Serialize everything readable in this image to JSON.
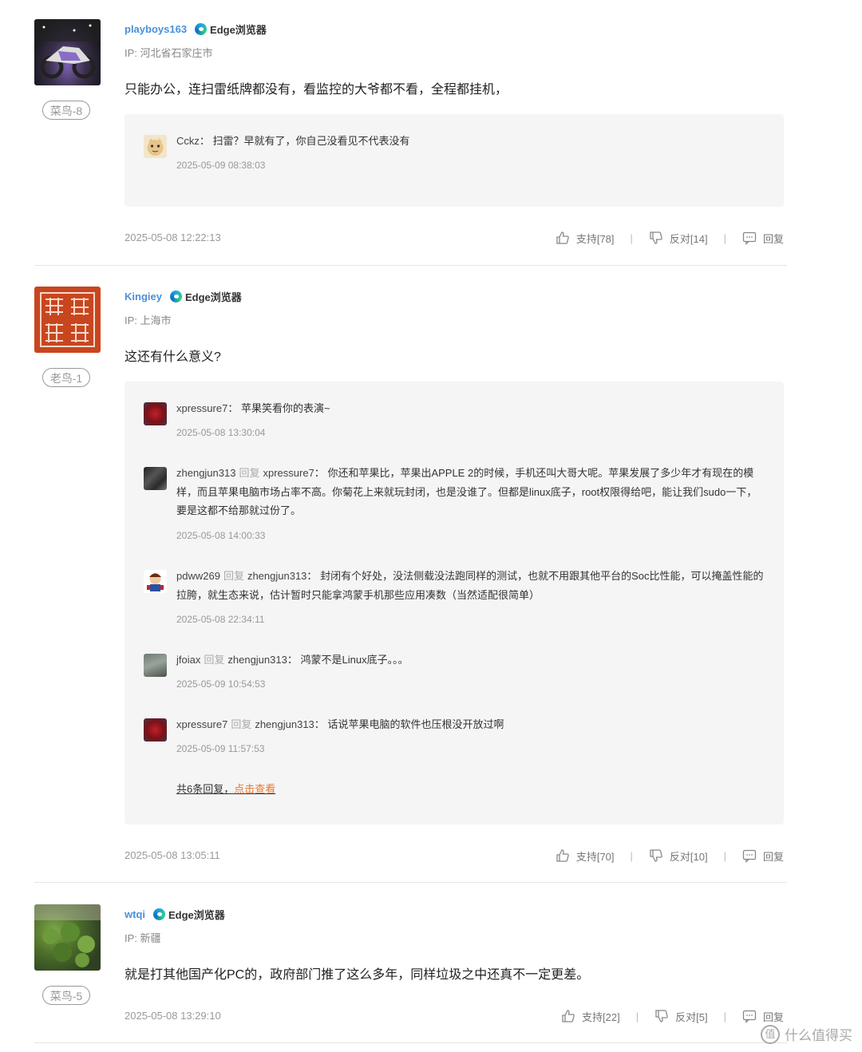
{
  "comments": [
    {
      "user": "playboys163",
      "browser": "Edge浏览器",
      "ip": "IP: 河北省石家庄市",
      "level": "菜鸟-8",
      "text": "只能办公，连扫雷纸牌都没有，看监控的大爷都不看，全程都挂机，",
      "time": "2025-05-08 12:22:13",
      "support": "支持[78]",
      "oppose": "反对[14]",
      "reply_label": "回复",
      "replies": [
        {
          "user": "Cckz",
          "to": "",
          "text": "扫雷？早就有了，你自己没看见不代表没有",
          "time": "2025-05-09 08:38:03"
        }
      ]
    },
    {
      "user": "Kingiey",
      "browser": "Edge浏览器",
      "ip": "IP: 上海市",
      "level": "老鸟-1",
      "text": "这还有什么意义?",
      "time": "2025-05-08 13:05:11",
      "support": "支持[70]",
      "oppose": "反对[10]",
      "reply_label": "回复",
      "replies": [
        {
          "user": "xpressure7",
          "to": "",
          "text": "苹果笑看你的表演~",
          "time": "2025-05-08 13:30:04"
        },
        {
          "user": "zhengjun313",
          "to": "xpressure7",
          "text": "你还和苹果比，苹果出APPLE 2的时候，手机还叫大哥大呢。苹果发展了多少年才有现在的模样，而且苹果电脑市场占率不高。你菊花上来就玩封闭，也是没谁了。但都是linux底子，root权限得给吧，能让我们sudo一下，要是这都不给那就过份了。",
          "time": "2025-05-08 14:00:33"
        },
        {
          "user": "pdww269",
          "to": "zhengjun313",
          "text": "封闭有个好处，没法侧载没法跑同样的测试，也就不用跟其他平台的Soc比性能，可以掩盖性能的拉胯，就生态来说，估计暂时只能拿鸿蒙手机那些应用凑数（当然适配很简单）",
          "time": "2025-05-08 22:34:11"
        },
        {
          "user": "jfoiax",
          "to": "zhengjun313",
          "text": "鸿蒙不是Linux底子。。。",
          "time": "2025-05-09 10:54:53"
        },
        {
          "user": "xpressure7",
          "to": "zhengjun313",
          "text": "话说苹果电脑的软件也压根没开放过啊",
          "time": "2025-05-09 11:57:53"
        }
      ],
      "more_text": "共6条回复，",
      "more_link": "点击查看"
    },
    {
      "user": "wtqi",
      "browser": "Edge浏览器",
      "ip": "IP: 新疆",
      "level": "菜鸟-5",
      "text": "就是打其他国产化PC的，政府部门推了这么多年，同样垃圾之中还真不一定更差。",
      "time": "2025-05-08 13:29:10",
      "support": "支持[22]",
      "oppose": "反对[5]",
      "reply_label": "回复",
      "replies": []
    }
  ],
  "reply_word": "回复",
  "colon": "：",
  "watermark": "什么值得买",
  "watermark_logo": "值"
}
